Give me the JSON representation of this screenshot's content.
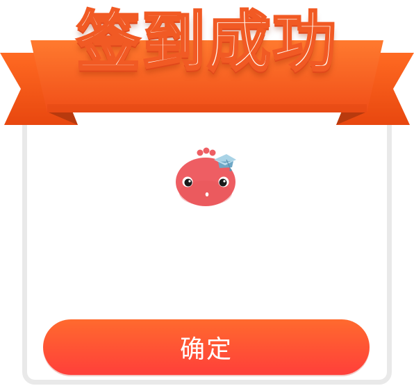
{
  "dialog": {
    "title": "签到成功",
    "confirm_label": "确定"
  },
  "icons": {
    "mascot": "octopus-graduate-mascot-icon"
  },
  "colors": {
    "ribbon": "#f15a24",
    "ribbon_dark": "#d63f12",
    "button_top": "#ff6a2e",
    "button_bottom": "#ff3f3a",
    "card_border": "#e9e9e9",
    "mascot_body": "#ef5f63"
  }
}
